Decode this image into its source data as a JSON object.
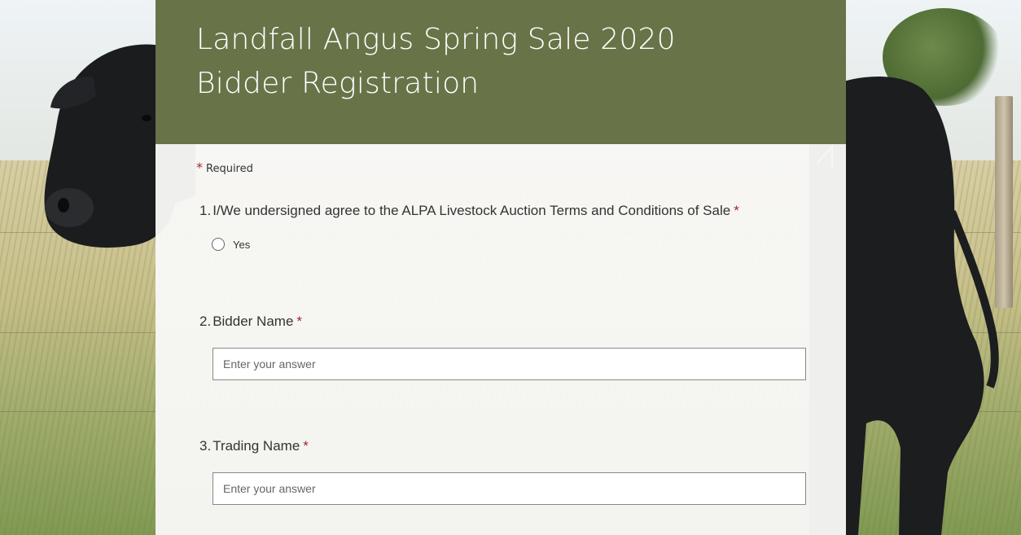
{
  "form": {
    "title_line1": "Landfall Angus Spring Sale 2020",
    "title_line2": "Bidder Registration",
    "header_color": "#687448",
    "required_star": "*",
    "required_label": "Required"
  },
  "questions": [
    {
      "number": "1.",
      "label": "I/We undersigned agree to the ALPA Livestock Auction Terms and Conditions of Sale",
      "required_star": "*",
      "type": "radio",
      "options": [
        "Yes"
      ]
    },
    {
      "number": "2.",
      "label": "Bidder Name",
      "required_star": "*",
      "type": "text",
      "placeholder": "Enter your answer",
      "value": ""
    },
    {
      "number": "3.",
      "label": "Trading Name",
      "required_star": "*",
      "type": "text",
      "placeholder": "Enter your answer",
      "value": ""
    }
  ],
  "colors": {
    "required_star": "#a4262c",
    "text": "#333333"
  }
}
